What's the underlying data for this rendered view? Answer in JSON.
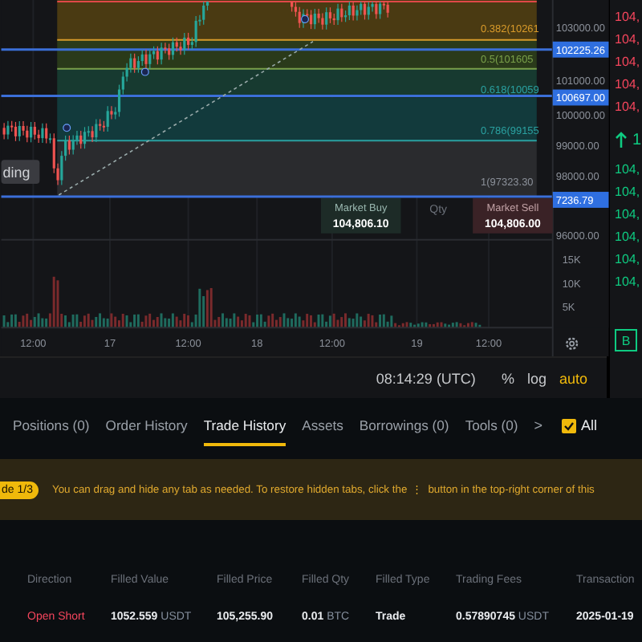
{
  "chart": {
    "fib_levels": [
      {
        "label": "0.382(10261"
      },
      {
        "label": "0.5(101605"
      },
      {
        "label": "0.618(10059"
      },
      {
        "label": "0.786(99155"
      },
      {
        "label": "1(97323.30"
      }
    ],
    "price_axis": [
      "103000.00",
      "101000.00",
      "100000.00",
      "99000.00",
      "98000.00",
      "96000.00"
    ],
    "price_badges": [
      "102225.26",
      "100697.00",
      "7236.79"
    ],
    "volume_axis": [
      "15K",
      "10K",
      "5K"
    ],
    "tag": "ding",
    "market_buy": {
      "label": "Market Buy",
      "price": "104,806.10"
    },
    "qty": "Qty",
    "market_sell": {
      "label": "Market Sell",
      "price": "104,806.00"
    },
    "time_axis": [
      "12:00",
      "17",
      "12:00",
      "18",
      "12:00",
      "19",
      "12:00"
    ]
  },
  "toolbar": {
    "time": "08:14:29 (UTC)",
    "options": [
      {
        "label": "%",
        "selected": false
      },
      {
        "label": "log",
        "selected": false
      },
      {
        "label": "auto",
        "selected": true
      }
    ]
  },
  "order_book": {
    "asks": [
      "104,",
      "104,",
      "104,",
      "104,",
      "104,"
    ],
    "last_price": "1",
    "bids": [
      "104,",
      "104,",
      "104,",
      "104,",
      "104,",
      "104,"
    ],
    "badge": "B"
  },
  "tabs": [
    {
      "label": "Positions (0)",
      "selected": false
    },
    {
      "label": "Order History",
      "selected": false
    },
    {
      "label": "Trade History",
      "selected": true
    },
    {
      "label": "Assets",
      "selected": false
    },
    {
      "label": "Borrowings (0)",
      "selected": false
    },
    {
      "label": "Tools (0)",
      "selected": false
    }
  ],
  "tabs_more": ">",
  "filter": {
    "label": "All",
    "checked": true
  },
  "banner": {
    "badge": "de 1/3",
    "text_before": "You can drag and hide any tab as needed. To restore hidden tabs, click the",
    "icon": "⋮",
    "text_after": "button in the top-right corner of this"
  },
  "table": {
    "columns": [
      "Direction",
      "Filled Value",
      "Filled Price",
      "Filled Qty",
      "Filled Type",
      "Trading Fees",
      "Transaction"
    ],
    "rows": [
      {
        "cells": [
          {
            "text": "Open Short",
            "kind": "sell"
          },
          {
            "text": "**1052.559** USDT",
            "kind": "plain"
          },
          {
            "text": "105,255.90",
            "kind": "strong"
          },
          {
            "text": "**0.01** BTC",
            "kind": "plain"
          },
          {
            "text": "Trade",
            "kind": "strong"
          },
          {
            "text": "**0.57890745** USDT",
            "kind": "plain"
          },
          {
            "text": "2025-01-19",
            "kind": "strong"
          }
        ]
      }
    ]
  }
}
